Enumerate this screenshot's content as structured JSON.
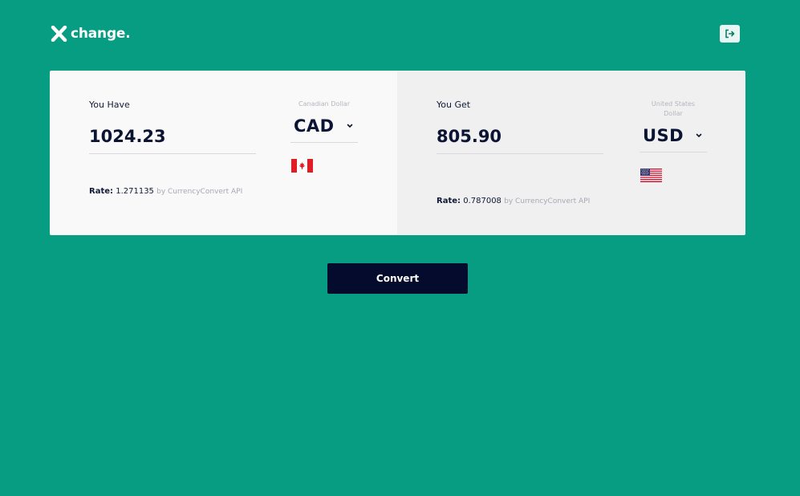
{
  "header": {
    "logo_mark": "X",
    "logo_text": "change.",
    "logout_icon": "logout-icon"
  },
  "from": {
    "label": "You Have",
    "amount": "1024.23",
    "currency_name": "Canadian Dollar",
    "currency_code": "CAD",
    "rate_key": "Rate:",
    "rate_value": "1.271135",
    "rate_source": "by CurrencyConvert API",
    "flag_icon": "canada-flag-icon"
  },
  "to": {
    "label": "You Get",
    "amount": "805.90",
    "currency_name": "United States Dollar",
    "currency_code": "USD",
    "rate_key": "Rate:",
    "rate_value": "0.787008",
    "rate_source": "by CurrencyConvert API",
    "flag_icon": "us-flag-icon"
  },
  "actions": {
    "convert_label": "Convert"
  },
  "colors": {
    "background": "#079d83",
    "card_left": "#f9f9f9",
    "card_right": "#f0f0f0",
    "button": "#050b2c",
    "text_dark": "#0b1433"
  }
}
